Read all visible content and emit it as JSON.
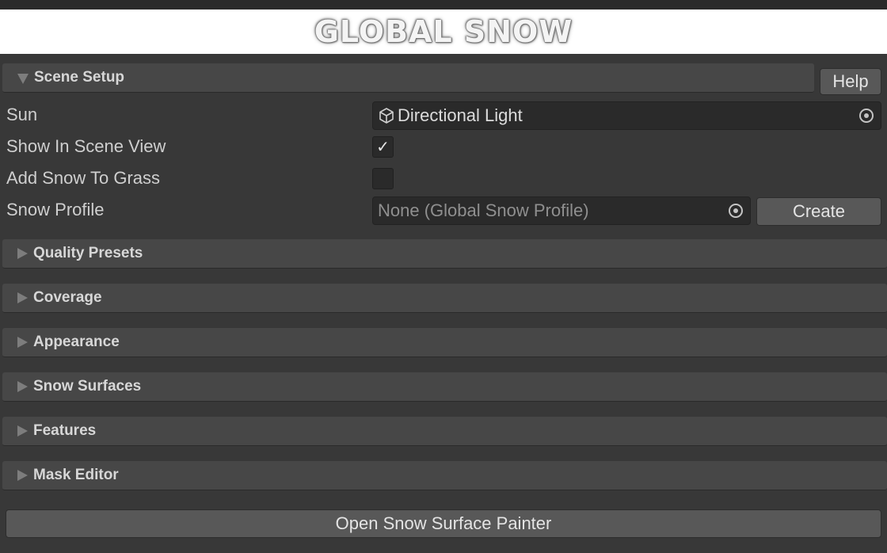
{
  "banner": {
    "title": "GLOBAL SNOW"
  },
  "scene_setup": {
    "header": "Scene Setup",
    "help_label": "Help",
    "fields": {
      "sun": {
        "label": "Sun",
        "value": "Directional Light",
        "icon": "cube-icon"
      },
      "show_in_scene_view": {
        "label": "Show In Scene View",
        "checked": true,
        "check_glyph": "✓"
      },
      "add_snow_to_grass": {
        "label": "Add Snow To Grass",
        "checked": false
      },
      "snow_profile": {
        "label": "Snow Profile",
        "value": "None (Global Snow Profile)",
        "create_label": "Create"
      }
    }
  },
  "sections": [
    {
      "label": "Quality Presets"
    },
    {
      "label": "Coverage"
    },
    {
      "label": "Appearance"
    },
    {
      "label": "Snow Surfaces"
    },
    {
      "label": "Features"
    },
    {
      "label": "Mask Editor"
    }
  ],
  "painter_button": {
    "label": "Open Snow Surface Painter"
  },
  "colors": {
    "background": "#383838",
    "foldout": "#474747",
    "field": "#2a2a2a",
    "button": "#585858"
  }
}
